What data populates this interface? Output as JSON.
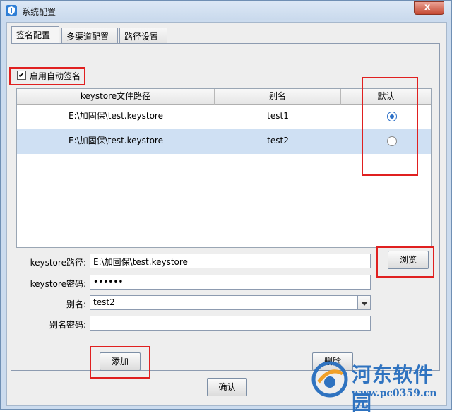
{
  "window": {
    "title": "系统配置",
    "close_label": "x"
  },
  "tabs": [
    {
      "label": "签名配置",
      "active": true
    },
    {
      "label": "多渠道配置",
      "active": false
    },
    {
      "label": "路径设置",
      "active": false
    }
  ],
  "auto_sign": {
    "label": "启用自动签名",
    "checked": true
  },
  "table": {
    "headers": [
      "keystore文件路径",
      "别名",
      "默认"
    ],
    "rows": [
      {
        "path": "E:\\加固保\\test.keystore",
        "alias": "test1",
        "default": true
      },
      {
        "path": "E:\\加固保\\test.keystore",
        "alias": "test2",
        "default": false
      }
    ]
  },
  "form": {
    "keystore_path_label": "keystore路径:",
    "keystore_path_value": "E:\\加固保\\test.keystore",
    "keystore_password_label": "keystore密码:",
    "keystore_password_value": "••••••",
    "alias_label": "别名:",
    "alias_value": "test2",
    "alias_password_label": "别名密码:",
    "alias_password_value": ""
  },
  "buttons": {
    "browse": "浏览",
    "add": "添加",
    "delete": "删除",
    "confirm": "确认"
  },
  "watermark": {
    "name": "河东软件园",
    "url": "www.pc0359.cn"
  },
  "colors": {
    "highlight": "#e02020",
    "selected_row": "#cfe0f3",
    "accent": "#2b6fc7"
  }
}
